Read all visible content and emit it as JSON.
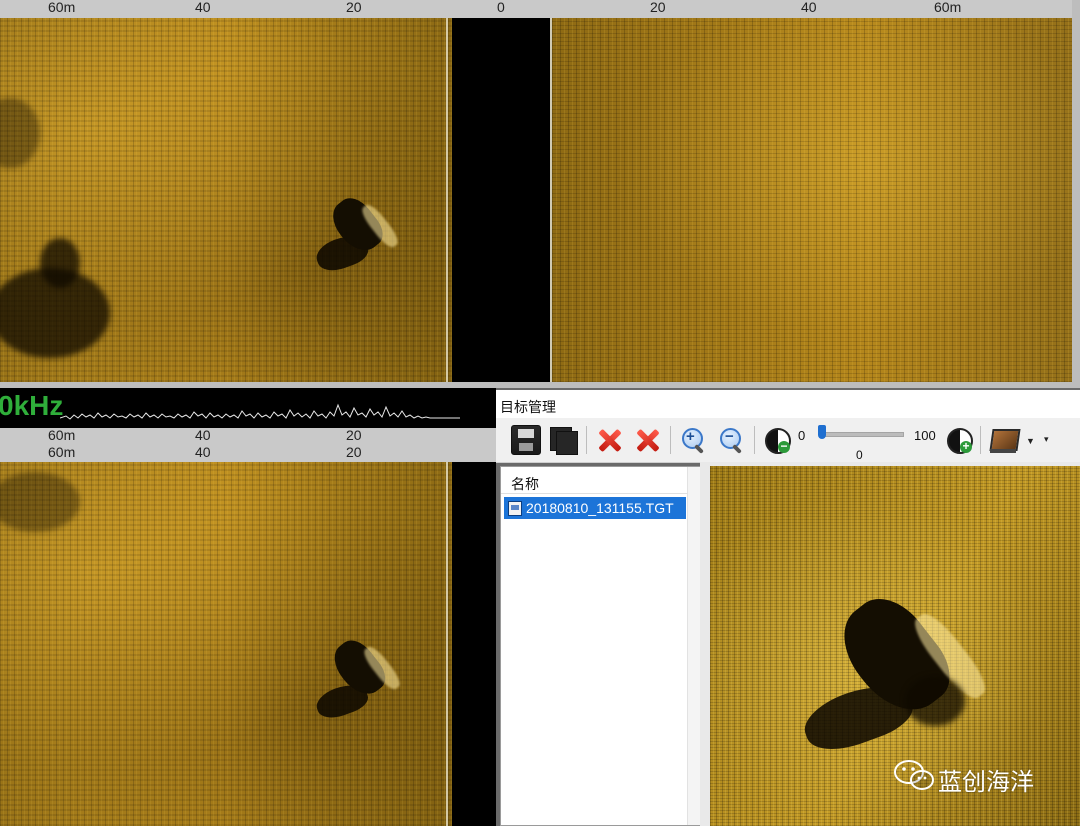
{
  "top_ruler": {
    "ticks": [
      "60m",
      "40",
      "20",
      "0",
      "20",
      "40",
      "60m"
    ]
  },
  "status_strip": {
    "frequency_label": "0kHz"
  },
  "lower_rulers": {
    "row1_ticks": [
      "60m",
      "40",
      "20"
    ],
    "row2_ticks": [
      "60m",
      "40",
      "20"
    ]
  },
  "target_panel": {
    "title": "目标管理",
    "toolbar": {
      "save_icon": "save-icon",
      "save_all_icon": "save-all-icon",
      "delete_icon": "delete-icon",
      "delete_all_icon": "delete-all-icon",
      "zoom_in_icon": "zoom-in-icon",
      "zoom_out_icon": "zoom-out-icon",
      "contrast_min_label": "0",
      "contrast_max_label": "100",
      "slider_value": "0",
      "slider_fraction": 0.0
    },
    "list": {
      "column_header": "名称",
      "items": [
        {
          "label": "20180810_131155.TGT",
          "selected": true
        }
      ]
    }
  },
  "watermark": {
    "text": "蓝创海洋"
  },
  "colors": {
    "sonar_gold": "#b88a1e",
    "selection_blue": "#1c74d8",
    "freq_green": "#2fae3a",
    "delete_red": "#d8281a"
  }
}
